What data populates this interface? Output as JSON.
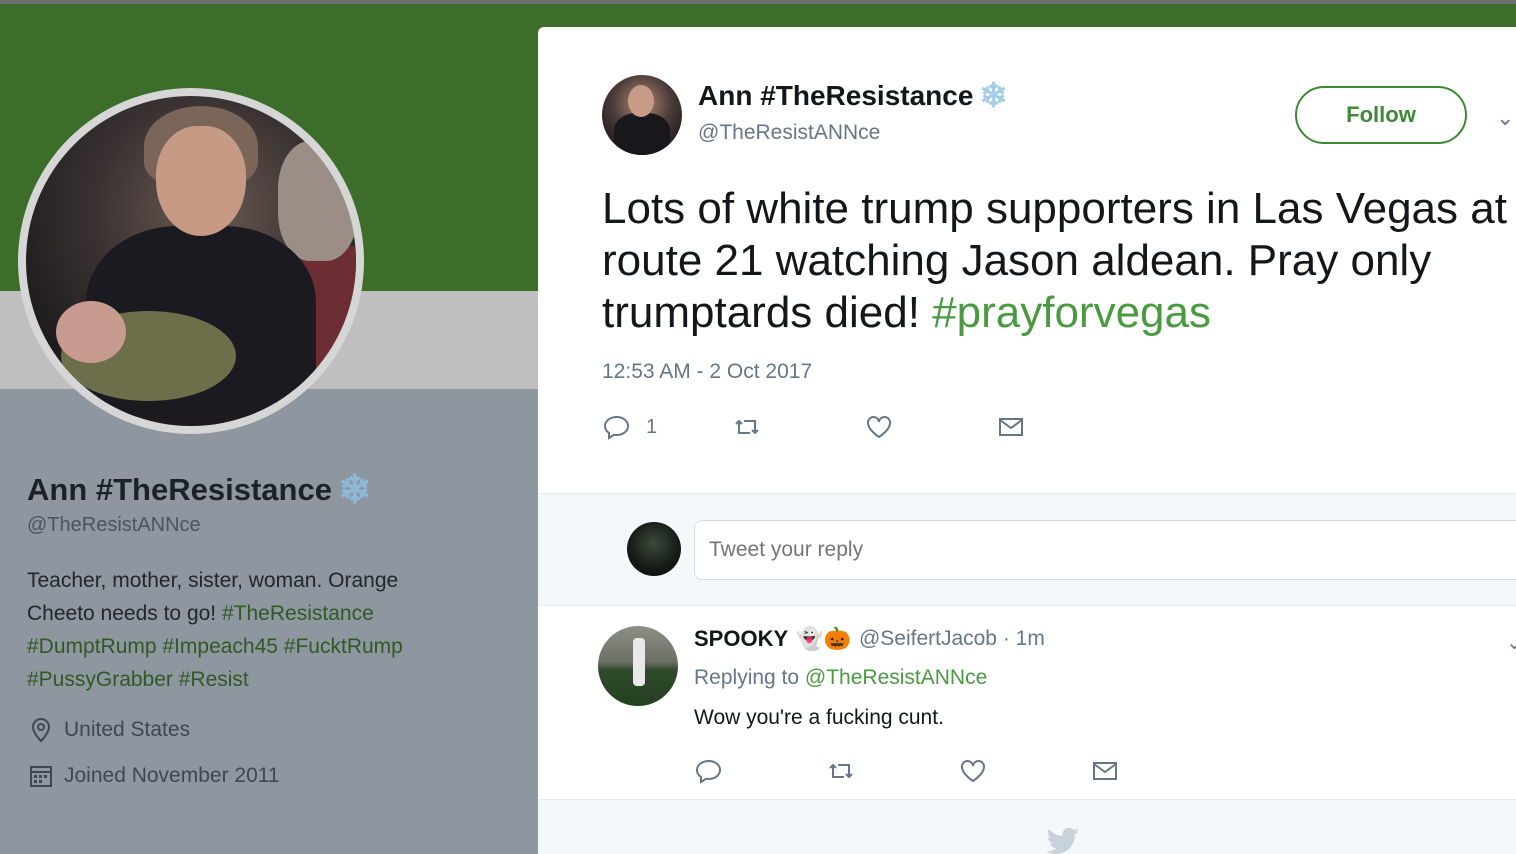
{
  "profile": {
    "name": "Ann #TheResistance",
    "handle": "@TheResistANNce",
    "bio_text": "Teacher, mother, sister, woman. Orange Cheeto needs to go!",
    "bio_tags_1": "#TheResistance",
    "bio_tags_2": "#DumptRump #Impeach45 #FucktRump #PussyGrabber #Resist",
    "location": "United States",
    "joined": "Joined November 2011"
  },
  "tweet": {
    "author_name": "Ann #TheResistance",
    "author_handle": "@TheResistANNce",
    "follow_label": "Follow",
    "text": "Lots of white trump supporters in Las Vegas at route 21 watching Jason aldean. Pray only trumptards died!",
    "hashtag": "#prayforvegas",
    "timestamp": "12:53 AM - 2 Oct 2017",
    "reply_count": "1"
  },
  "reply_box": {
    "placeholder": "Tweet your reply"
  },
  "reply": {
    "name": "SPOOKY",
    "emoji": "👻🎃",
    "handle_time": "@SeifertJacob · 1m",
    "replying_prefix": "Replying to",
    "replying_to": "@TheResistANNce",
    "text": "Wow you're a fucking cunt."
  },
  "colors": {
    "accent": "#3c8a35",
    "banner": "#3c6e2a",
    "muted": "#657786"
  }
}
